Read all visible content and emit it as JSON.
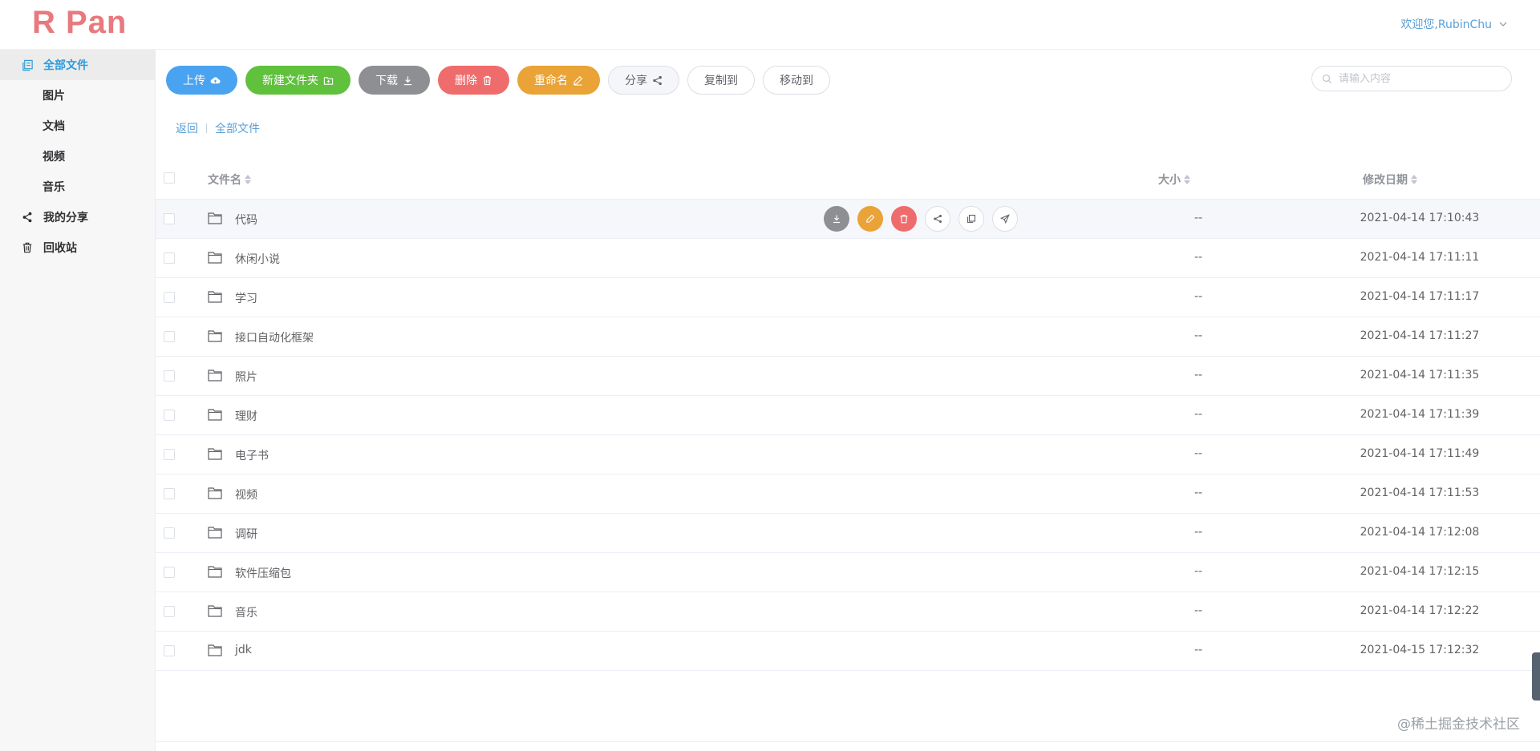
{
  "app": {
    "logo": "R Pan",
    "user_greeting": "欢迎您,RubinChu"
  },
  "sidebar": {
    "items": [
      {
        "label": "全部文件",
        "icon": "files-icon"
      },
      {
        "label": "图片"
      },
      {
        "label": "文档"
      },
      {
        "label": "视频"
      },
      {
        "label": "音乐"
      },
      {
        "label": "我的分享",
        "icon": "share-icon"
      },
      {
        "label": "回收站",
        "icon": "trash-icon"
      }
    ]
  },
  "toolbar": {
    "upload": "上传",
    "new_folder": "新建文件夹",
    "download": "下载",
    "delete": "删除",
    "rename": "重命名",
    "share": "分享",
    "copy_to": "复制到",
    "move_to": "移动到"
  },
  "search": {
    "placeholder": "请输入内容"
  },
  "breadcrumb": {
    "back": "返回",
    "current": "全部文件"
  },
  "table": {
    "columns": {
      "name": "文件名",
      "size": "大小",
      "date": "修改日期"
    },
    "rows": [
      {
        "name": "代码",
        "size": "--",
        "date": "2021-04-14 17:10:43"
      },
      {
        "name": "休闲小说",
        "size": "--",
        "date": "2021-04-14 17:11:11"
      },
      {
        "name": "学习",
        "size": "--",
        "date": "2021-04-14 17:11:17"
      },
      {
        "name": "接口自动化框架",
        "size": "--",
        "date": "2021-04-14 17:11:27"
      },
      {
        "name": "照片",
        "size": "--",
        "date": "2021-04-14 17:11:35"
      },
      {
        "name": "理财",
        "size": "--",
        "date": "2021-04-14 17:11:39"
      },
      {
        "name": "电子书",
        "size": "--",
        "date": "2021-04-14 17:11:49"
      },
      {
        "name": "视频",
        "size": "--",
        "date": "2021-04-14 17:11:53"
      },
      {
        "name": "调研",
        "size": "--",
        "date": "2021-04-14 17:12:08"
      },
      {
        "name": "软件压缩包",
        "size": "--",
        "date": "2021-04-14 17:12:15"
      },
      {
        "name": "音乐",
        "size": "--",
        "date": "2021-04-14 17:12:22"
      },
      {
        "name": "jdk",
        "size": "--",
        "date": "2021-04-15 17:12:32"
      }
    ]
  },
  "watermark": "@稀土掘金技术社区",
  "colors": {
    "logo": "#e8797e",
    "accent": "#2d9cdb",
    "upload": "#4aa3f0",
    "new_folder": "#5fc13c",
    "download": "#8e8f92",
    "delete": "#ef6c6c",
    "rename": "#e9a336"
  }
}
